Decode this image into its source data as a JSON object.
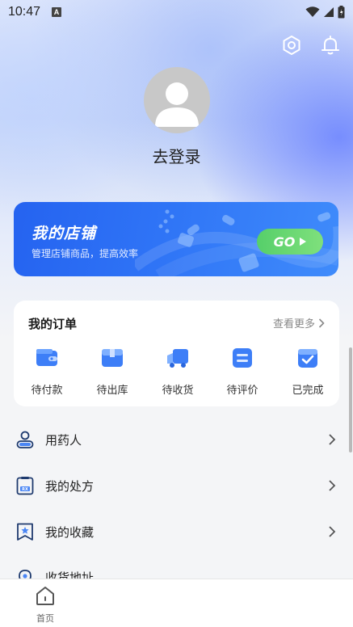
{
  "status_bar": {
    "time": "10:47",
    "notification_badge": "A"
  },
  "header": {
    "login_text": "去登录"
  },
  "store_banner": {
    "title": "我的店铺",
    "subtitle": "管理店铺商品，提高效率",
    "go_label": "GO",
    "colors": {
      "start": "#2563f0",
      "end": "#3f8bfb",
      "go": "#56cf6a"
    }
  },
  "orders": {
    "title": "我的订单",
    "more_label": "查看更多",
    "items": [
      {
        "label": "待付款",
        "icon": "wallet-icon"
      },
      {
        "label": "待出库",
        "icon": "box-icon"
      },
      {
        "label": "待收货",
        "icon": "truck-icon"
      },
      {
        "label": "待评价",
        "icon": "review-icon"
      },
      {
        "label": "已完成",
        "icon": "check-icon"
      }
    ]
  },
  "menu": {
    "items": [
      {
        "label": "用药人",
        "icon": "person-icon"
      },
      {
        "label": "我的处方",
        "icon": "prescription-icon"
      },
      {
        "label": "我的收藏",
        "icon": "favorite-icon"
      },
      {
        "label": "收货地址",
        "icon": "location-icon"
      }
    ]
  },
  "tabbar": {
    "home_label": "首页"
  },
  "colors": {
    "accent": "#2f74f6",
    "page_bg": "#f4f5f7"
  }
}
